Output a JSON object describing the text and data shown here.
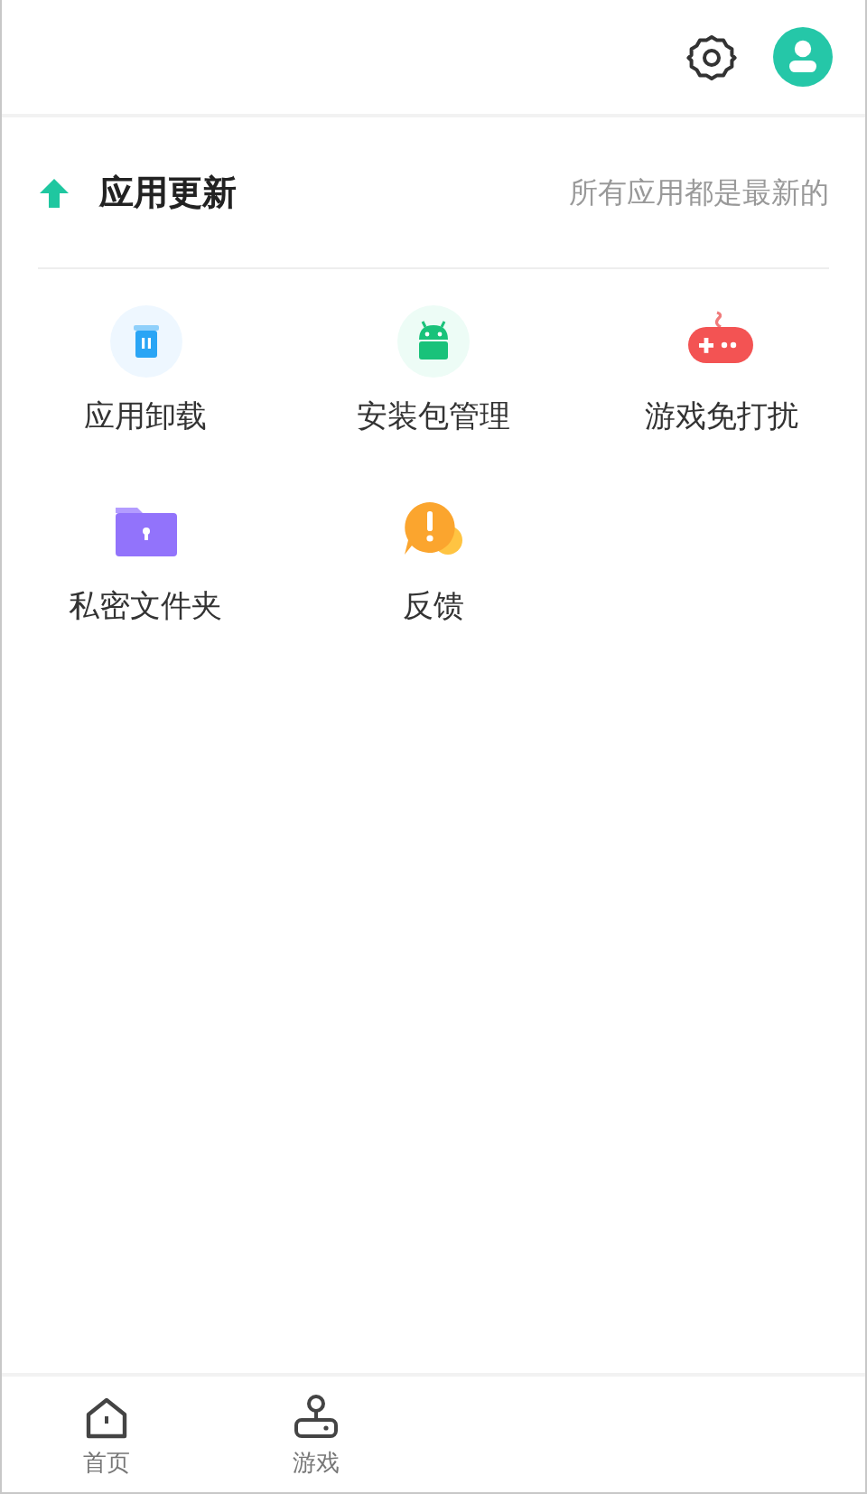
{
  "update": {
    "title": "应用更新",
    "status": "所有应用都是最新的"
  },
  "tools": [
    {
      "kind": "uninstall",
      "label": "应用卸载"
    },
    {
      "kind": "apk",
      "label": "安装包管理"
    },
    {
      "kind": "game",
      "label": "游戏免打扰"
    },
    {
      "kind": "folder",
      "label": "私密文件夹"
    },
    {
      "kind": "feedback",
      "label": "反馈"
    }
  ],
  "bottom_nav": [
    {
      "kind": "home",
      "label": "首页"
    },
    {
      "kind": "games",
      "label": "游戏"
    }
  ]
}
